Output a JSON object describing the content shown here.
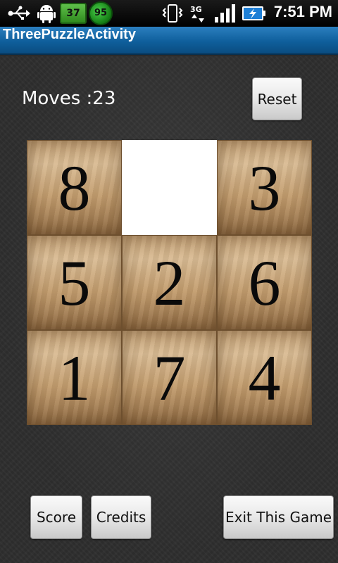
{
  "status_bar": {
    "battery_level_badge": "37",
    "circle_badge": "95",
    "time": "7:51 PM",
    "icons": [
      "usb-icon",
      "android-debug-icon",
      "vibrate-icon",
      "data-3g-icon",
      "signal-icon",
      "battery-charging-icon"
    ]
  },
  "app": {
    "title": "ThreePuzzleActivity"
  },
  "game": {
    "moves_label": "Moves :23",
    "reset_label": "Reset",
    "tiles": [
      "8",
      "",
      "3",
      "5",
      "2",
      "6",
      "1",
      "7",
      "4"
    ]
  },
  "footer": {
    "score_label": "Score",
    "credits_label": "Credits",
    "exit_label": "Exit This Game"
  },
  "colors": {
    "title_bar": "#0f5f9c",
    "background": "#2e2e2e",
    "tile_wood": "#c29c6d",
    "blank_tile": "#ffffff"
  }
}
